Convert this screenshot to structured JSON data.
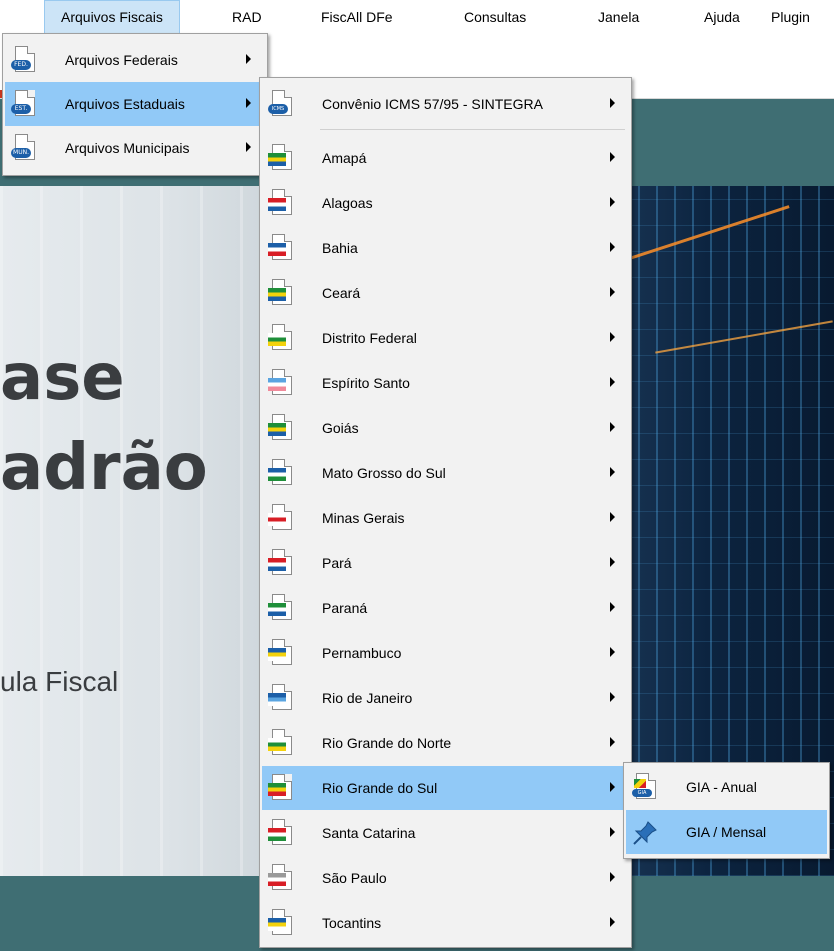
{
  "menubar": {
    "items": [
      "Arquivos Fiscais",
      "RAD",
      "FiscAll DFe",
      "Consultas",
      "Janela",
      "Ajuda",
      "Plugin"
    ],
    "active": "Arquivos Fiscais"
  },
  "banner": {
    "title_line1": "ase",
    "title_line2": "adrão",
    "subtitle": "ula Fiscal"
  },
  "menu1": {
    "items": [
      {
        "label": "Arquivos Federais",
        "icon_tag": "FED.",
        "icon": "document-fed-icon"
      },
      {
        "label": "Arquivos Estaduais",
        "icon_tag": "EST.",
        "icon": "document-est-icon"
      },
      {
        "label": "Arquivos Municipais",
        "icon_tag": "MUN.",
        "icon": "document-mun-icon"
      }
    ],
    "highlighted": "Arquivos Estaduais"
  },
  "menu2": {
    "header": {
      "label": "Convênio ICMS 57/95 - SINTEGRA",
      "icon_tag": "ICMS"
    },
    "states": [
      {
        "label": "Amapá",
        "colors": [
          "#1f8f3a",
          "#f4d20c",
          "#1c5fa8"
        ]
      },
      {
        "label": "Alagoas",
        "colors": [
          "#d81e26",
          "#ffffff",
          "#1c5fa8"
        ]
      },
      {
        "label": "Bahia",
        "colors": [
          "#1c5fa8",
          "#ffffff",
          "#d81e26"
        ]
      },
      {
        "label": "Ceará",
        "colors": [
          "#1f8f3a",
          "#f4d20c",
          "#1c5fa8"
        ]
      },
      {
        "label": "Distrito Federal",
        "colors": [
          "#ffffff",
          "#1f8f3a",
          "#f4d20c"
        ]
      },
      {
        "label": "Espírito Santo",
        "colors": [
          "#5aa4e0",
          "#ffffff",
          "#f08a9a"
        ]
      },
      {
        "label": "Goiás",
        "colors": [
          "#1f8f3a",
          "#f4d20c",
          "#1c5fa8"
        ]
      },
      {
        "label": "Mato Grosso do Sul",
        "colors": [
          "#1c5fa8",
          "#ffffff",
          "#1f8f3a"
        ]
      },
      {
        "label": "Minas Gerais",
        "colors": [
          "#ffffff",
          "#d81e26",
          "#ffffff"
        ]
      },
      {
        "label": "Pará",
        "colors": [
          "#d81e26",
          "#ffffff",
          "#1c5fa8"
        ]
      },
      {
        "label": "Paraná",
        "colors": [
          "#1f8f3a",
          "#ffffff",
          "#1c5fa8"
        ]
      },
      {
        "label": "Pernambuco",
        "colors": [
          "#1c5fa8",
          "#f4d20c",
          "#ffffff"
        ]
      },
      {
        "label": "Rio de Janeiro",
        "colors": [
          "#1c5fa8",
          "#5aa4e0",
          "#ffffff"
        ]
      },
      {
        "label": "Rio Grande do Norte",
        "colors": [
          "#ffffff",
          "#1f8f3a",
          "#f4d20c"
        ]
      },
      {
        "label": "Rio Grande do Sul",
        "colors": [
          "#1f8f3a",
          "#f4d20c",
          "#d81e26"
        ]
      },
      {
        "label": "Santa Catarina",
        "colors": [
          "#d81e26",
          "#ffffff",
          "#1f8f3a"
        ]
      },
      {
        "label": "São Paulo",
        "colors": [
          "#9a9a9a",
          "#ffffff",
          "#d81e26"
        ]
      },
      {
        "label": "Tocantins",
        "colors": [
          "#1c5fa8",
          "#f4d20c",
          "#ffffff"
        ]
      }
    ],
    "highlighted": "Rio Grande do Sul"
  },
  "menu3": {
    "items": [
      {
        "label": "GIA - Anual",
        "icon": "document-gia-icon",
        "icon_tag": "GIA"
      },
      {
        "label": "GIA / Mensal",
        "icon": "pin-icon"
      }
    ],
    "highlighted": "GIA / Mensal"
  },
  "colors": {
    "highlight": "#91c9f7",
    "menubar_active": "#cce4f7",
    "background": "#3f6e73"
  }
}
